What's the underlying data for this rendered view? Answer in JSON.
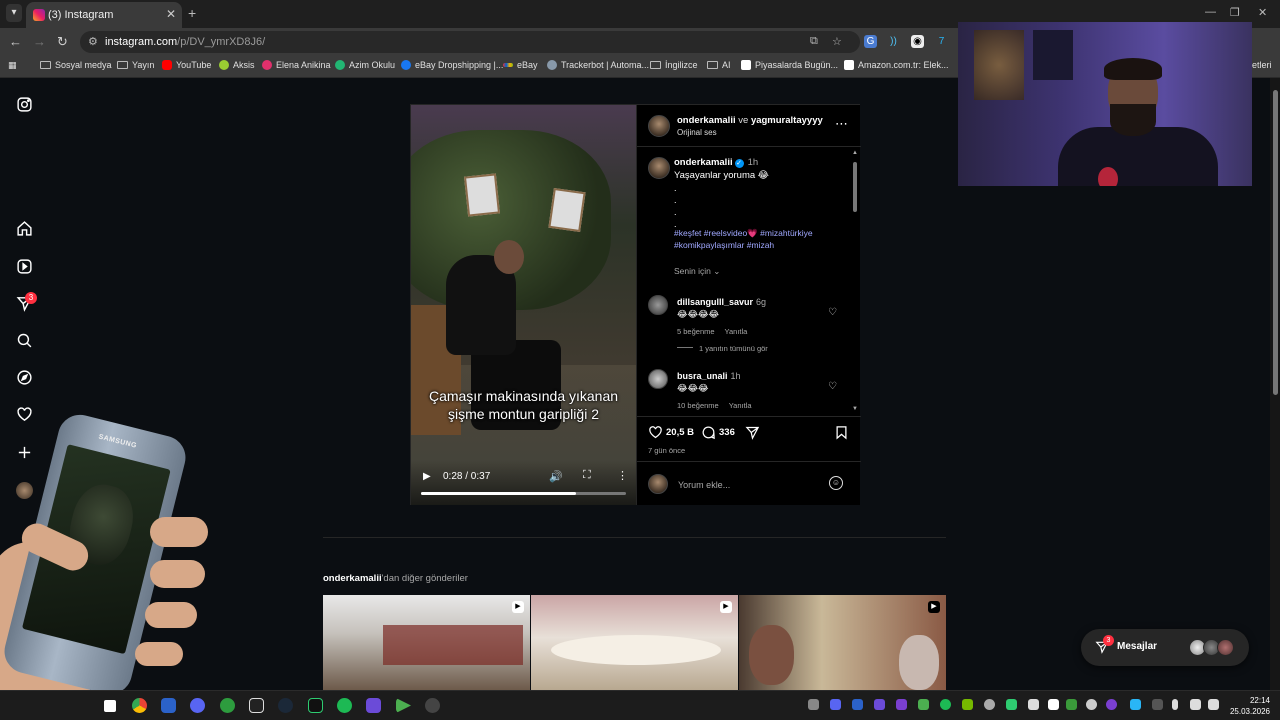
{
  "browser": {
    "tab_title": "(3) Instagram",
    "url_host": "instagram.com",
    "url_path": "/p/DV_ymrXD8J6/",
    "bookmarks": [
      {
        "label": "Sosyal medya",
        "icon": "folder-icon"
      },
      {
        "label": "Yayın",
        "icon": "folder-icon"
      },
      {
        "label": "YouTube",
        "icon": "youtube-icon",
        "color": "#ff0000"
      },
      {
        "label": "Aksis",
        "icon": "aksis-icon",
        "color": "#9acd32"
      },
      {
        "label": "Elena Anikina",
        "icon": "instagram-icon",
        "color": "#e1306c"
      },
      {
        "label": "Azim Okulu",
        "icon": "azim-icon",
        "color": "#22b573"
      },
      {
        "label": "eBay Dropshipping |...",
        "icon": "facebook-icon",
        "color": "#1877f2"
      },
      {
        "label": "eBay",
        "icon": "ebay-icon",
        "color": "#e53238"
      },
      {
        "label": "Trackerbot | Automa...",
        "icon": "trackerbot-icon",
        "color": "#8899aa"
      },
      {
        "label": "İngilizce",
        "icon": "folder-icon"
      },
      {
        "label": "AI",
        "icon": "folder-icon"
      },
      {
        "label": "Piyasalarda Bugün...",
        "icon": "tv-icon",
        "color": "#ffffff"
      },
      {
        "label": "Amazon.com.tr: Elek...",
        "icon": "amazon-icon",
        "color": "#ffffff"
      },
      {
        "label": "etleri",
        "icon": "",
        "color": ""
      }
    ]
  },
  "sidebar": {
    "notification_count": "3"
  },
  "post": {
    "author": "onderkamalii",
    "conjunction": "ve",
    "coauthor": "yagmuraltayyyy",
    "audio": "Orijinal ses",
    "caption_user": "onderkamalii",
    "caption_time": "1h",
    "caption_text": "Yaşayanlar yoruma 😂",
    "caption_dots": [
      ".",
      ".",
      ".",
      "."
    ],
    "hashtags": "#keşfet #reelsvideo💗 #mizahtürkiye #komikpaylaşımlar #mizah",
    "for_you": "Senin için",
    "video": {
      "overlay_text": "Çamaşır makinasında yıkanan şişme montun garipliği 2",
      "time": "0:28 / 0:37",
      "progress": 0.757
    },
    "comments": [
      {
        "user": "dillsangulll_savur",
        "time": "6g",
        "text": "😂😂😂😂",
        "likes": "5 beğenme",
        "reply": "Yanıtla"
      },
      {
        "user": "busra_unali",
        "time": "1h",
        "text": "😂😂😂",
        "likes": "10 beğenme",
        "reply": "Yanıtla"
      }
    ],
    "view_replies": "1 yanıtın tümünü gör",
    "like_count": "20,5 B",
    "comment_count": "336",
    "posted_ago": "7 gün önce",
    "comment_placeholder": "Yorum ekle..."
  },
  "more_posts": {
    "user": "onderkamalii",
    "suffix": "'dan diğer gönderiler"
  },
  "messages": {
    "label": "Mesajlar",
    "count": "3"
  },
  "phone": {
    "brand": "SAMSUNG"
  },
  "clock": {
    "time": "22:14",
    "date": "25.03.2026"
  },
  "colors": {
    "instagram_bg": "#0b0e12",
    "badge_red": "#ff3040",
    "hashtag_blue": "#a0a8ff",
    "verified_blue": "#0095f6"
  }
}
